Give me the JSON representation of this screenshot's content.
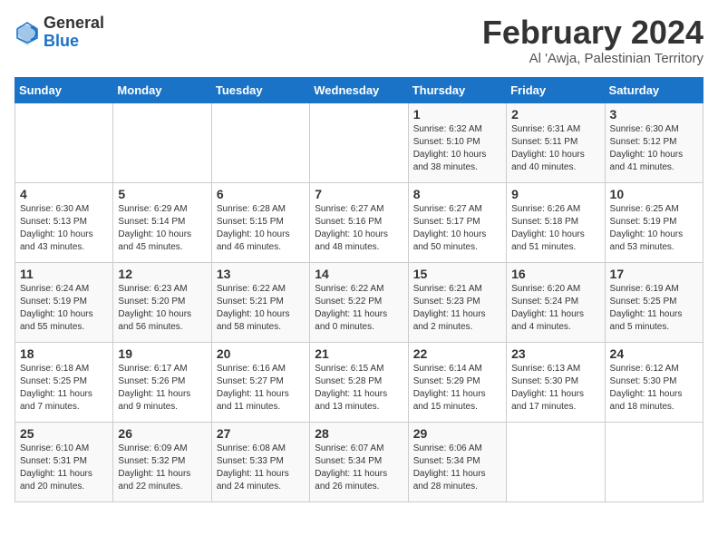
{
  "logo": {
    "general": "General",
    "blue": "Blue"
  },
  "title": "February 2024",
  "subtitle": "Al 'Awja, Palestinian Territory",
  "days_of_week": [
    "Sunday",
    "Monday",
    "Tuesday",
    "Wednesday",
    "Thursday",
    "Friday",
    "Saturday"
  ],
  "weeks": [
    [
      {
        "day": "",
        "info": ""
      },
      {
        "day": "",
        "info": ""
      },
      {
        "day": "",
        "info": ""
      },
      {
        "day": "",
        "info": ""
      },
      {
        "day": "1",
        "info": "Sunrise: 6:32 AM\nSunset: 5:10 PM\nDaylight: 10 hours\nand 38 minutes."
      },
      {
        "day": "2",
        "info": "Sunrise: 6:31 AM\nSunset: 5:11 PM\nDaylight: 10 hours\nand 40 minutes."
      },
      {
        "day": "3",
        "info": "Sunrise: 6:30 AM\nSunset: 5:12 PM\nDaylight: 10 hours\nand 41 minutes."
      }
    ],
    [
      {
        "day": "4",
        "info": "Sunrise: 6:30 AM\nSunset: 5:13 PM\nDaylight: 10 hours\nand 43 minutes."
      },
      {
        "day": "5",
        "info": "Sunrise: 6:29 AM\nSunset: 5:14 PM\nDaylight: 10 hours\nand 45 minutes."
      },
      {
        "day": "6",
        "info": "Sunrise: 6:28 AM\nSunset: 5:15 PM\nDaylight: 10 hours\nand 46 minutes."
      },
      {
        "day": "7",
        "info": "Sunrise: 6:27 AM\nSunset: 5:16 PM\nDaylight: 10 hours\nand 48 minutes."
      },
      {
        "day": "8",
        "info": "Sunrise: 6:27 AM\nSunset: 5:17 PM\nDaylight: 10 hours\nand 50 minutes."
      },
      {
        "day": "9",
        "info": "Sunrise: 6:26 AM\nSunset: 5:18 PM\nDaylight: 10 hours\nand 51 minutes."
      },
      {
        "day": "10",
        "info": "Sunrise: 6:25 AM\nSunset: 5:19 PM\nDaylight: 10 hours\nand 53 minutes."
      }
    ],
    [
      {
        "day": "11",
        "info": "Sunrise: 6:24 AM\nSunset: 5:19 PM\nDaylight: 10 hours\nand 55 minutes."
      },
      {
        "day": "12",
        "info": "Sunrise: 6:23 AM\nSunset: 5:20 PM\nDaylight: 10 hours\nand 56 minutes."
      },
      {
        "day": "13",
        "info": "Sunrise: 6:22 AM\nSunset: 5:21 PM\nDaylight: 10 hours\nand 58 minutes."
      },
      {
        "day": "14",
        "info": "Sunrise: 6:22 AM\nSunset: 5:22 PM\nDaylight: 11 hours\nand 0 minutes."
      },
      {
        "day": "15",
        "info": "Sunrise: 6:21 AM\nSunset: 5:23 PM\nDaylight: 11 hours\nand 2 minutes."
      },
      {
        "day": "16",
        "info": "Sunrise: 6:20 AM\nSunset: 5:24 PM\nDaylight: 11 hours\nand 4 minutes."
      },
      {
        "day": "17",
        "info": "Sunrise: 6:19 AM\nSunset: 5:25 PM\nDaylight: 11 hours\nand 5 minutes."
      }
    ],
    [
      {
        "day": "18",
        "info": "Sunrise: 6:18 AM\nSunset: 5:25 PM\nDaylight: 11 hours\nand 7 minutes."
      },
      {
        "day": "19",
        "info": "Sunrise: 6:17 AM\nSunset: 5:26 PM\nDaylight: 11 hours\nand 9 minutes."
      },
      {
        "day": "20",
        "info": "Sunrise: 6:16 AM\nSunset: 5:27 PM\nDaylight: 11 hours\nand 11 minutes."
      },
      {
        "day": "21",
        "info": "Sunrise: 6:15 AM\nSunset: 5:28 PM\nDaylight: 11 hours\nand 13 minutes."
      },
      {
        "day": "22",
        "info": "Sunrise: 6:14 AM\nSunset: 5:29 PM\nDaylight: 11 hours\nand 15 minutes."
      },
      {
        "day": "23",
        "info": "Sunrise: 6:13 AM\nSunset: 5:30 PM\nDaylight: 11 hours\nand 17 minutes."
      },
      {
        "day": "24",
        "info": "Sunrise: 6:12 AM\nSunset: 5:30 PM\nDaylight: 11 hours\nand 18 minutes."
      }
    ],
    [
      {
        "day": "25",
        "info": "Sunrise: 6:10 AM\nSunset: 5:31 PM\nDaylight: 11 hours\nand 20 minutes."
      },
      {
        "day": "26",
        "info": "Sunrise: 6:09 AM\nSunset: 5:32 PM\nDaylight: 11 hours\nand 22 minutes."
      },
      {
        "day": "27",
        "info": "Sunrise: 6:08 AM\nSunset: 5:33 PM\nDaylight: 11 hours\nand 24 minutes."
      },
      {
        "day": "28",
        "info": "Sunrise: 6:07 AM\nSunset: 5:34 PM\nDaylight: 11 hours\nand 26 minutes."
      },
      {
        "day": "29",
        "info": "Sunrise: 6:06 AM\nSunset: 5:34 PM\nDaylight: 11 hours\nand 28 minutes."
      },
      {
        "day": "",
        "info": ""
      },
      {
        "day": "",
        "info": ""
      }
    ]
  ]
}
